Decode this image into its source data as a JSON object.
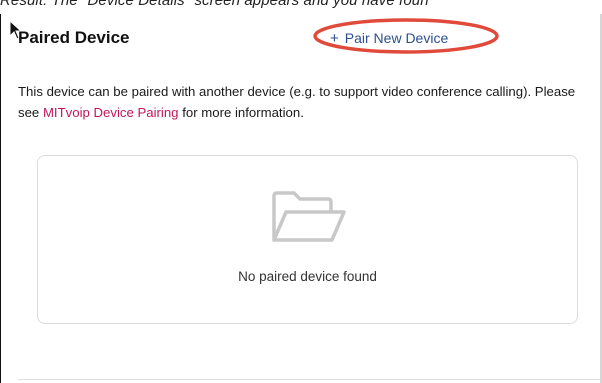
{
  "caption": "Result: The \"Device Details\" screen appears and you have foun",
  "panel": {
    "title": "Paired Device",
    "pair_button": {
      "icon": "plus-icon",
      "label": "Pair New Device"
    },
    "description": {
      "before_link": "This device can be paired with another device (e.g. to support video conference calling). Please see ",
      "link_text": "MITvoip Device Pairing",
      "after_link": " for more information."
    },
    "empty_state": {
      "icon": "folder-icon",
      "message": "No paired device found"
    }
  },
  "colors": {
    "link": "#c2185b",
    "button_text": "#2d4f8f",
    "annotation": "#e04a3a",
    "card_border": "#dcdcdc"
  }
}
